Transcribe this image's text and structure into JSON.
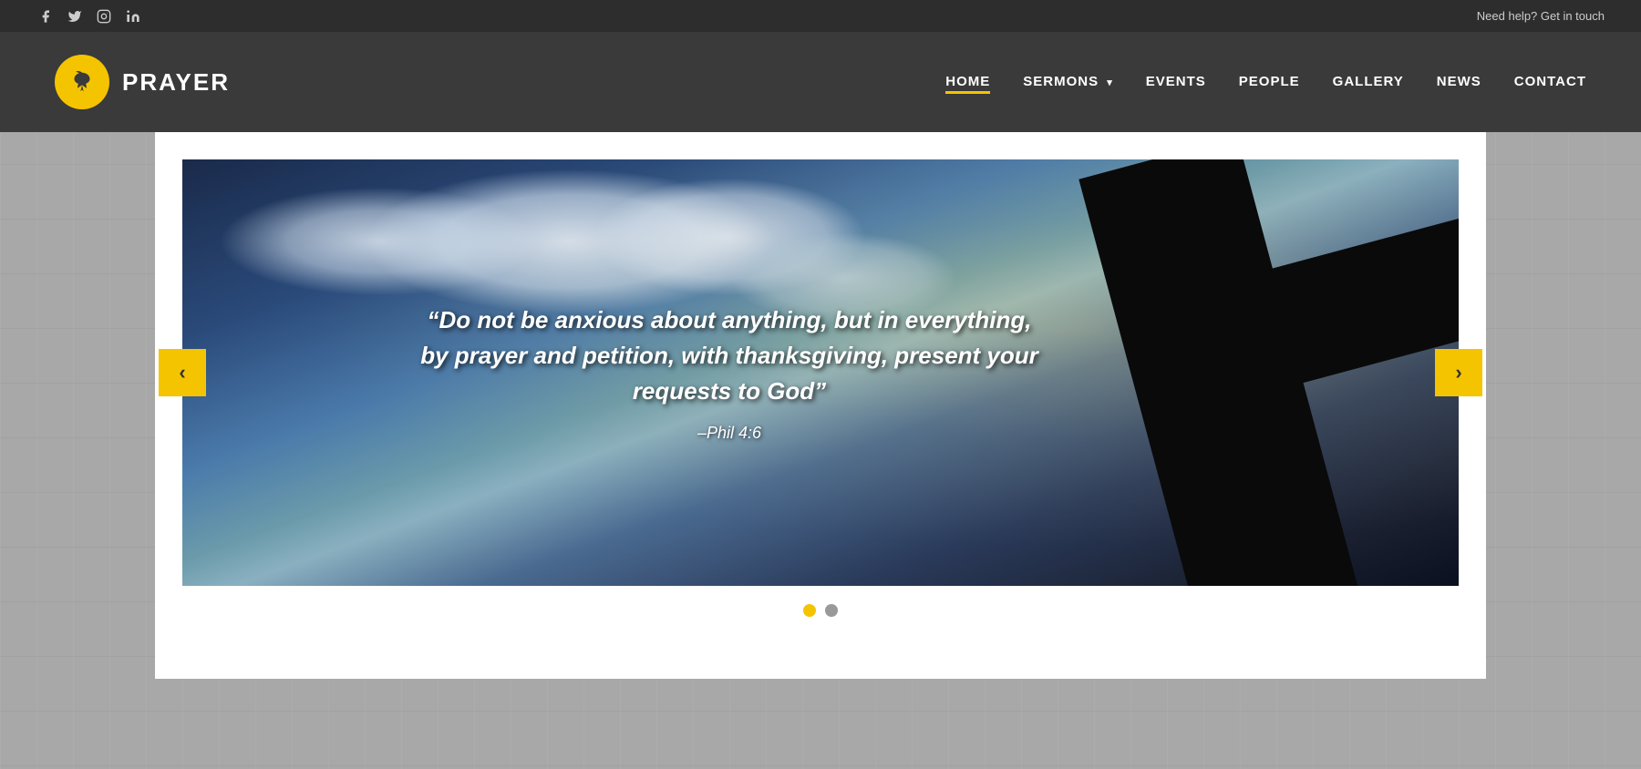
{
  "topbar": {
    "help_text": "Need help? Get in touch",
    "social_icons": [
      {
        "name": "facebook-icon",
        "symbol": "f"
      },
      {
        "name": "twitter-icon",
        "symbol": "t"
      },
      {
        "name": "instagram-icon",
        "symbol": "i"
      },
      {
        "name": "linkedin-icon",
        "symbol": "in"
      }
    ]
  },
  "header": {
    "logo_text": "PRAYER",
    "nav_items": [
      {
        "label": "HOME",
        "active": true,
        "has_dropdown": false
      },
      {
        "label": "SERMONS",
        "active": false,
        "has_dropdown": true
      },
      {
        "label": "EVENTS",
        "active": false,
        "has_dropdown": false
      },
      {
        "label": "PEOPLE",
        "active": false,
        "has_dropdown": false
      },
      {
        "label": "GALLERY",
        "active": false,
        "has_dropdown": false
      },
      {
        "label": "NEWS",
        "active": false,
        "has_dropdown": false
      },
      {
        "label": "CONTACT",
        "active": false,
        "has_dropdown": false
      }
    ]
  },
  "slider": {
    "quote": "“Do not be anxious about anything, but in everything, by prayer and petition, with thanksgiving, present your requests to God”",
    "reference": "–Phil 4:6",
    "prev_arrow": "‹",
    "next_arrow": "›",
    "dots": [
      {
        "active": true
      },
      {
        "active": false
      }
    ]
  }
}
